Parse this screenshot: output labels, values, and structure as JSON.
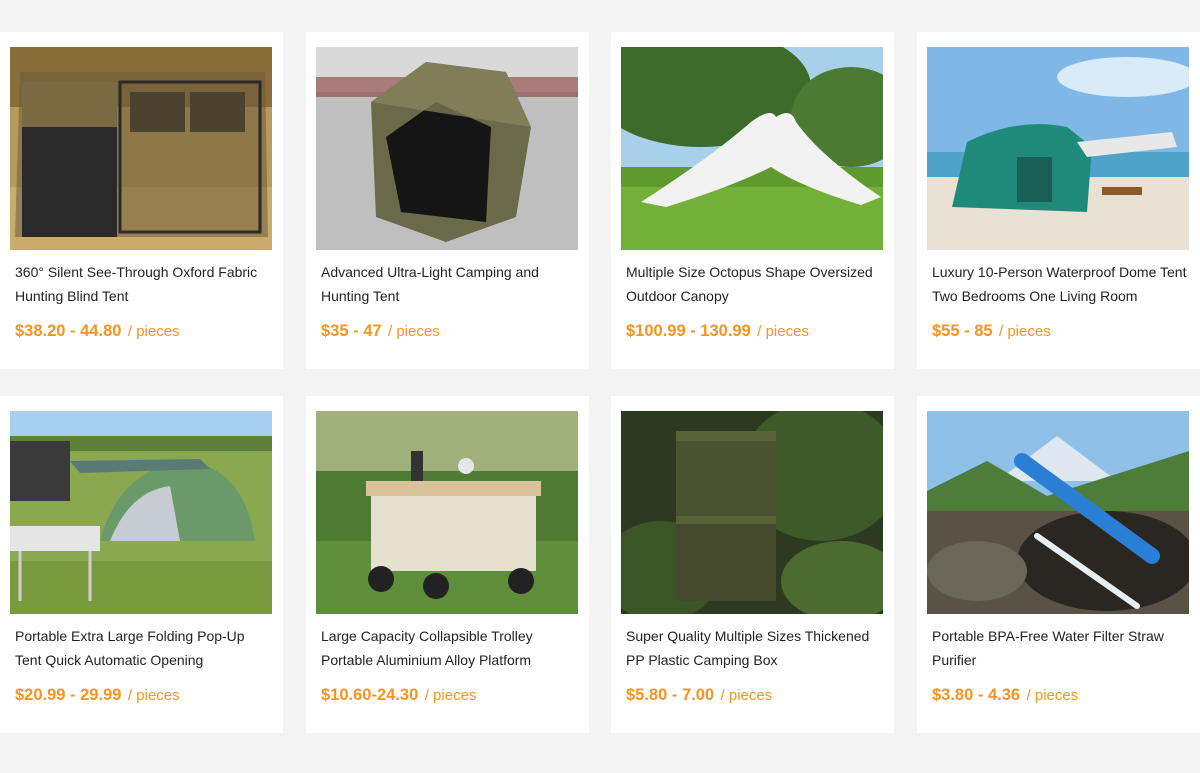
{
  "products": [
    {
      "title": "360° Silent See-Through Oxford Fabric Hunting Blind Tent",
      "price": "$38.20 - 44.80",
      "unit": "/ pieces",
      "image": "camouflage-hunting-blind-tent-photo"
    },
    {
      "title": "Advanced Ultra-Light Camping and Hunting Tent",
      "price": "$35 - 47",
      "unit": "/ pieces",
      "image": "camo-hub-hunting-tent-photo"
    },
    {
      "title": "Multiple Size Octopus Shape Oversized Outdoor Canopy",
      "price": "$100.99 - 130.99",
      "unit": "/ pieces",
      "image": "white-octopus-canopy-photo"
    },
    {
      "title": "Luxury 10-Person Waterproof Dome Tent Two Bedrooms One Living Room",
      "price": "$55 - 85",
      "unit": "/ pieces",
      "image": "teal-dome-tent-beach-photo"
    },
    {
      "title": "Portable Extra Large Folding Pop-Up Tent Quick Automatic Opening",
      "price": "$20.99 - 29.99",
      "unit": "/ pieces",
      "image": "green-popup-tent-meadow-photo"
    },
    {
      "title": "Large Capacity Collapsible Trolley Portable Aluminium Alloy Platform",
      "price": "$10.60-24.30",
      "unit": "/ pieces",
      "image": "folding-wagon-trolley-photo"
    },
    {
      "title": "Super Quality Multiple Sizes Thickened PP Plastic Camping Box",
      "price": "$5.80 - 7.00",
      "unit": "/ pieces",
      "image": "olive-storage-box-photo"
    },
    {
      "title": "Portable BPA-Free Water Filter Straw Purifier",
      "price": "$3.80 - 4.36",
      "unit": "/ pieces",
      "image": "blue-water-filter-straw-photo"
    }
  ],
  "theme": {
    "price_color": "#f7931e",
    "page_bg": "#f3f3f3",
    "card_bg": "#ffffff"
  }
}
